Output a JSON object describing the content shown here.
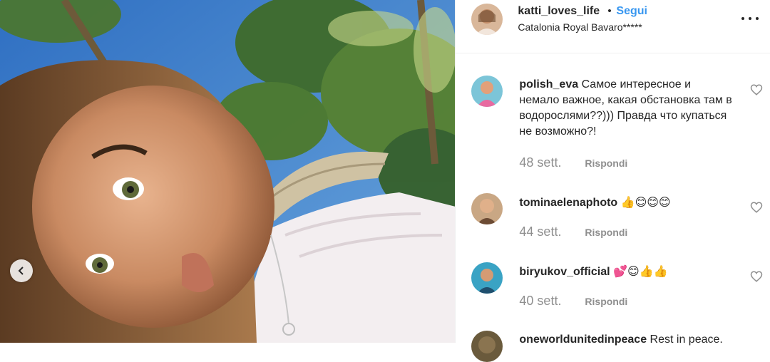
{
  "post": {
    "author": {
      "username": "katti_loves_life",
      "follow_label": "Segui",
      "separator": "•",
      "location": "Catalonia Royal Bavaro*****"
    },
    "more_icon": "more-options-icon",
    "carousel_prev_icon": "chevron-left-icon"
  },
  "comments": [
    {
      "username": "polish_eva",
      "text": "Самое интересное и немало важное, какая обстановка там в водорослями??))) Правда что купаться не возможно?!",
      "time": "48 sett.",
      "reply_label": "Rispondi"
    },
    {
      "username": "tominaelenaphoto",
      "text": "👍😊😊😊",
      "time": "44 sett.",
      "reply_label": "Rispondi"
    },
    {
      "username": "biryukov_official",
      "text": "💕😊👍👍",
      "time": "40 sett.",
      "reply_label": "Rispondi"
    },
    {
      "username": "oneworldunitedinpeace",
      "text": "Rest in peace."
    }
  ],
  "colors": {
    "link_blue": "#3897f0",
    "text": "#262626",
    "muted": "#8e8e8e",
    "divider": "#efefef"
  }
}
